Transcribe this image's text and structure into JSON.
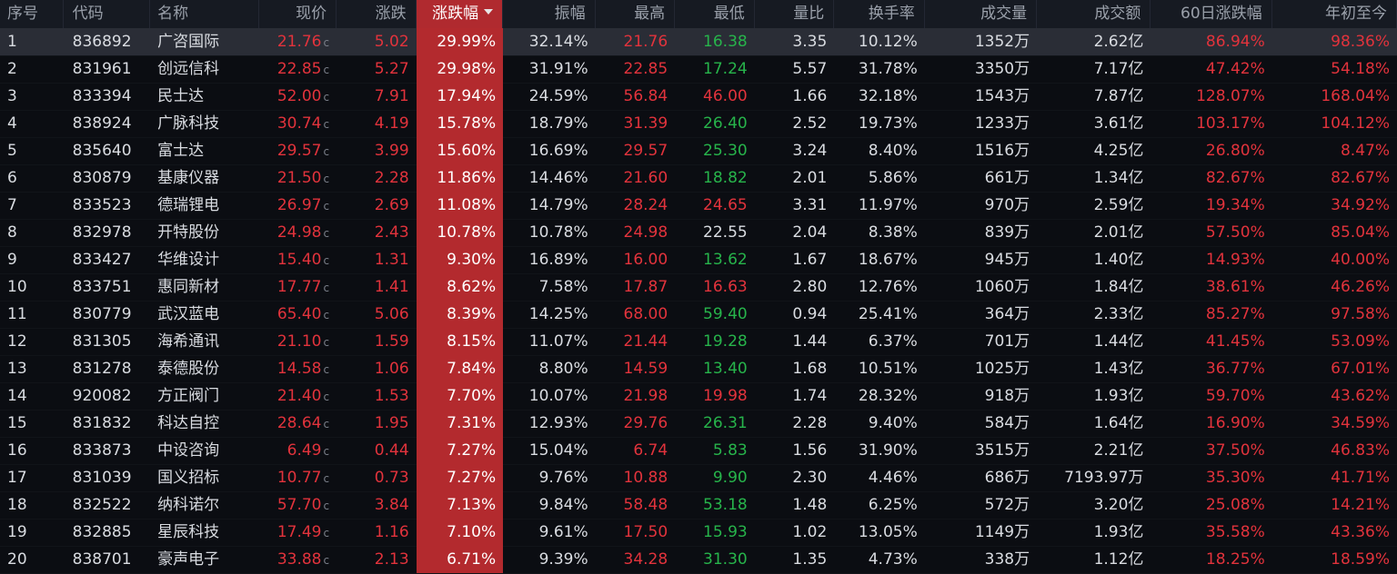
{
  "colors": {
    "up": "#e2333c",
    "down": "#27b44b",
    "neutral": "#d9dce1",
    "highlight": "#b32a2e",
    "background": "#0b0d12"
  },
  "headers": {
    "idx": "序号",
    "code": "代码",
    "name": "名称",
    "price": "现价",
    "chg": "涨跌",
    "pct": "涨跌幅",
    "amp": "振幅",
    "high": "最高",
    "low": "最低",
    "vr": "量比",
    "turn": "换手率",
    "vol": "成交量",
    "amt": "成交额",
    "d60": "60日涨跌幅",
    "ytd": "年初至今"
  },
  "sort_icon": "sort-desc-icon",
  "flag": "c",
  "rows": [
    {
      "idx": "1",
      "code": "836892",
      "name": "广咨国际",
      "price": "21.76",
      "chg": "5.02",
      "pct": "29.99%",
      "amp": "32.14%",
      "high": "21.76",
      "high_c": "up",
      "low": "16.38",
      "low_c": "down",
      "vr": "3.35",
      "turn": "10.12%",
      "vol": "1352万",
      "amt": "2.62亿",
      "d60": "86.94%",
      "ytd": "98.36%"
    },
    {
      "idx": "2",
      "code": "831961",
      "name": "创远信科",
      "price": "22.85",
      "chg": "5.27",
      "pct": "29.98%",
      "amp": "31.91%",
      "high": "22.85",
      "high_c": "up",
      "low": "17.24",
      "low_c": "down",
      "vr": "5.57",
      "turn": "31.78%",
      "vol": "3350万",
      "amt": "7.17亿",
      "d60": "47.42%",
      "ytd": "54.18%"
    },
    {
      "idx": "3",
      "code": "833394",
      "name": "民士达",
      "price": "52.00",
      "chg": "7.91",
      "pct": "17.94%",
      "amp": "24.59%",
      "high": "56.84",
      "high_c": "up",
      "low": "46.00",
      "low_c": "up",
      "vr": "1.66",
      "turn": "32.18%",
      "vol": "1543万",
      "amt": "7.87亿",
      "d60": "128.07%",
      "ytd": "168.04%"
    },
    {
      "idx": "4",
      "code": "838924",
      "name": "广脉科技",
      "price": "30.74",
      "chg": "4.19",
      "pct": "15.78%",
      "amp": "18.79%",
      "high": "31.39",
      "high_c": "up",
      "low": "26.40",
      "low_c": "down",
      "vr": "2.52",
      "turn": "19.73%",
      "vol": "1233万",
      "amt": "3.61亿",
      "d60": "103.17%",
      "ytd": "104.12%"
    },
    {
      "idx": "5",
      "code": "835640",
      "name": "富士达",
      "price": "29.57",
      "chg": "3.99",
      "pct": "15.60%",
      "amp": "16.69%",
      "high": "29.57",
      "high_c": "up",
      "low": "25.30",
      "low_c": "down",
      "vr": "3.24",
      "turn": "8.40%",
      "vol": "1516万",
      "amt": "4.25亿",
      "d60": "26.80%",
      "ytd": "8.47%"
    },
    {
      "idx": "6",
      "code": "830879",
      "name": "基康仪器",
      "price": "21.50",
      "chg": "2.28",
      "pct": "11.86%",
      "amp": "14.46%",
      "high": "21.60",
      "high_c": "up",
      "low": "18.82",
      "low_c": "down",
      "vr": "2.01",
      "turn": "5.86%",
      "vol": "661万",
      "amt": "1.34亿",
      "d60": "82.67%",
      "ytd": "82.67%"
    },
    {
      "idx": "7",
      "code": "833523",
      "name": "德瑞锂电",
      "price": "26.97",
      "chg": "2.69",
      "pct": "11.08%",
      "amp": "14.79%",
      "high": "28.24",
      "high_c": "up",
      "low": "24.65",
      "low_c": "up",
      "vr": "3.31",
      "turn": "11.97%",
      "vol": "970万",
      "amt": "2.59亿",
      "d60": "19.34%",
      "ytd": "34.92%"
    },
    {
      "idx": "8",
      "code": "832978",
      "name": "开特股份",
      "price": "24.98",
      "chg": "2.43",
      "pct": "10.78%",
      "amp": "10.78%",
      "high": "24.98",
      "high_c": "up",
      "low": "22.55",
      "low_c": "neutral",
      "vr": "2.04",
      "turn": "8.38%",
      "vol": "839万",
      "amt": "2.01亿",
      "d60": "57.50%",
      "ytd": "85.04%"
    },
    {
      "idx": "9",
      "code": "833427",
      "name": "华维设计",
      "price": "15.40",
      "chg": "1.31",
      "pct": "9.30%",
      "amp": "16.89%",
      "high": "16.00",
      "high_c": "up",
      "low": "13.62",
      "low_c": "down",
      "vr": "1.67",
      "turn": "18.67%",
      "vol": "945万",
      "amt": "1.40亿",
      "d60": "14.93%",
      "ytd": "40.00%"
    },
    {
      "idx": "10",
      "code": "833751",
      "name": "惠同新材",
      "price": "17.77",
      "chg": "1.41",
      "pct": "8.62%",
      "amp": "7.58%",
      "high": "17.87",
      "high_c": "up",
      "low": "16.63",
      "low_c": "up",
      "vr": "2.80",
      "turn": "12.76%",
      "vol": "1060万",
      "amt": "1.84亿",
      "d60": "38.61%",
      "ytd": "46.26%"
    },
    {
      "idx": "11",
      "code": "830779",
      "name": "武汉蓝电",
      "price": "65.40",
      "chg": "5.06",
      "pct": "8.39%",
      "amp": "14.25%",
      "high": "68.00",
      "high_c": "up",
      "low": "59.40",
      "low_c": "down",
      "vr": "0.94",
      "turn": "25.41%",
      "vol": "364万",
      "amt": "2.33亿",
      "d60": "85.27%",
      "ytd": "97.58%"
    },
    {
      "idx": "12",
      "code": "831305",
      "name": "海希通讯",
      "price": "21.10",
      "chg": "1.59",
      "pct": "8.15%",
      "amp": "11.07%",
      "high": "21.44",
      "high_c": "up",
      "low": "19.28",
      "low_c": "down",
      "vr": "1.44",
      "turn": "6.37%",
      "vol": "701万",
      "amt": "1.44亿",
      "d60": "41.45%",
      "ytd": "53.09%"
    },
    {
      "idx": "13",
      "code": "831278",
      "name": "泰德股份",
      "price": "14.58",
      "chg": "1.06",
      "pct": "7.84%",
      "amp": "8.80%",
      "high": "14.59",
      "high_c": "up",
      "low": "13.40",
      "low_c": "down",
      "vr": "1.68",
      "turn": "10.51%",
      "vol": "1025万",
      "amt": "1.43亿",
      "d60": "36.77%",
      "ytd": "67.01%"
    },
    {
      "idx": "14",
      "code": "920082",
      "name": "方正阀门",
      "price": "21.40",
      "chg": "1.53",
      "pct": "7.70%",
      "amp": "10.07%",
      "high": "21.98",
      "high_c": "up",
      "low": "19.98",
      "low_c": "up",
      "vr": "1.74",
      "turn": "28.32%",
      "vol": "918万",
      "amt": "1.93亿",
      "d60": "59.70%",
      "ytd": "43.62%"
    },
    {
      "idx": "15",
      "code": "831832",
      "name": "科达自控",
      "price": "28.64",
      "chg": "1.95",
      "pct": "7.31%",
      "amp": "12.93%",
      "high": "29.76",
      "high_c": "up",
      "low": "26.31",
      "low_c": "down",
      "vr": "2.28",
      "turn": "9.40%",
      "vol": "584万",
      "amt": "1.64亿",
      "d60": "16.90%",
      "ytd": "34.59%"
    },
    {
      "idx": "16",
      "code": "833873",
      "name": "中设咨询",
      "price": "6.49",
      "chg": "0.44",
      "pct": "7.27%",
      "amp": "15.04%",
      "high": "6.74",
      "high_c": "up",
      "low": "5.83",
      "low_c": "down",
      "vr": "1.56",
      "turn": "31.90%",
      "vol": "3515万",
      "amt": "2.21亿",
      "d60": "37.50%",
      "ytd": "46.83%"
    },
    {
      "idx": "17",
      "code": "831039",
      "name": "国义招标",
      "price": "10.77",
      "chg": "0.73",
      "pct": "7.27%",
      "amp": "9.76%",
      "high": "10.88",
      "high_c": "up",
      "low": "9.90",
      "low_c": "down",
      "vr": "2.30",
      "turn": "4.46%",
      "vol": "686万",
      "amt": "7193.97万",
      "d60": "35.30%",
      "ytd": "41.71%"
    },
    {
      "idx": "18",
      "code": "832522",
      "name": "纳科诺尔",
      "price": "57.70",
      "chg": "3.84",
      "pct": "7.13%",
      "amp": "9.84%",
      "high": "58.48",
      "high_c": "up",
      "low": "53.18",
      "low_c": "down",
      "vr": "1.48",
      "turn": "6.25%",
      "vol": "572万",
      "amt": "3.20亿",
      "d60": "25.08%",
      "ytd": "14.21%"
    },
    {
      "idx": "19",
      "code": "832885",
      "name": "星辰科技",
      "price": "17.49",
      "chg": "1.16",
      "pct": "7.10%",
      "amp": "9.61%",
      "high": "17.50",
      "high_c": "up",
      "low": "15.93",
      "low_c": "down",
      "vr": "1.02",
      "turn": "13.05%",
      "vol": "1149万",
      "amt": "1.93亿",
      "d60": "35.58%",
      "ytd": "43.36%"
    },
    {
      "idx": "20",
      "code": "838701",
      "name": "豪声电子",
      "price": "33.88",
      "chg": "2.13",
      "pct": "6.71%",
      "amp": "9.39%",
      "high": "34.28",
      "high_c": "up",
      "low": "31.30",
      "low_c": "down",
      "vr": "1.35",
      "turn": "4.73%",
      "vol": "338万",
      "amt": "1.12亿",
      "d60": "18.25%",
      "ytd": "18.59%"
    }
  ]
}
